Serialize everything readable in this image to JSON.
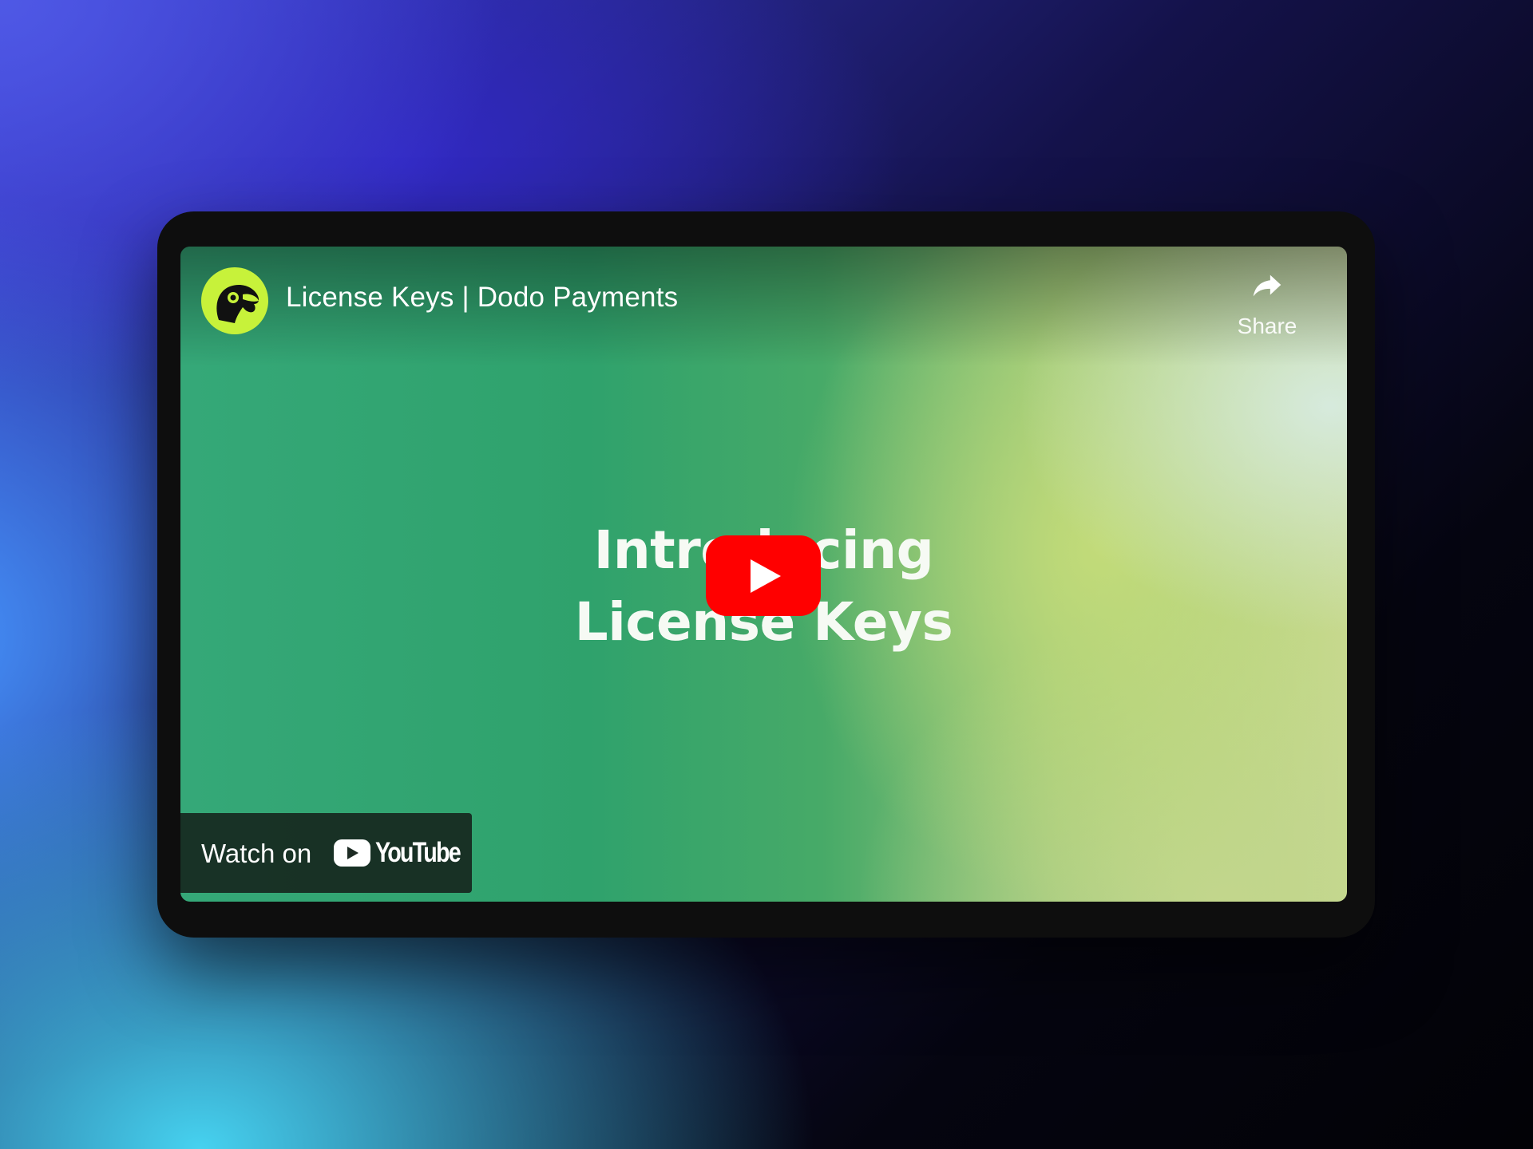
{
  "video": {
    "title": "License Keys | Dodo Payments",
    "channel_avatar_icon": "dodo-bird-logo-icon",
    "channel_avatar_color": "#c7f23a",
    "share": {
      "label": "Share",
      "icon": "share-arrow-icon"
    },
    "overlay_text": {
      "line1": "Introducing",
      "line2": "License Keys"
    },
    "play_button": {
      "icon": "play-icon",
      "color": "#ff0000"
    },
    "watch_on": {
      "label": "Watch on",
      "brand": "YouTube",
      "brand_icon": "youtube-logo-icon"
    }
  }
}
